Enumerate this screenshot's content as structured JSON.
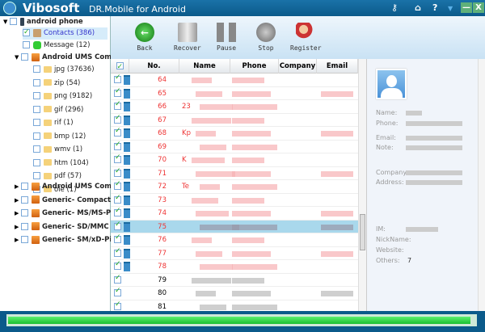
{
  "title": {
    "brand": "Vibosoft",
    "subtitle": "DR.Mobile for Android"
  },
  "tree": {
    "root": "android phone",
    "contacts": "Contacts (386)",
    "message": "Message (12)",
    "storage": "Android   UMS Com...",
    "folders": [
      "jpg (37636)",
      "zip (54)",
      "png (9182)",
      "gif (296)",
      "rif (1)",
      "bmp (12)",
      "wmv (1)",
      "htm (104)",
      "pdf (57)",
      "ole (1)"
    ],
    "drives": [
      "Android   UMS Com...",
      "Generic- Compact Fl...",
      "Generic- MS/MS-Pr...",
      "Generic- SD/MMC U...",
      "Generic- SM/xD-Pic..."
    ]
  },
  "toolbar": {
    "back": "Back",
    "recover": "Recover",
    "pause": "Pause",
    "stop": "Stop",
    "register": "Register"
  },
  "table": {
    "headers": [
      "No.",
      "Name",
      "Phone",
      "Company",
      "Email"
    ],
    "rows": [
      {
        "no": "64",
        "name": "",
        "deleted": true
      },
      {
        "no": "65",
        "name": "",
        "deleted": true
      },
      {
        "no": "66",
        "name": "23",
        "deleted": true
      },
      {
        "no": "67",
        "name": "",
        "deleted": true
      },
      {
        "no": "68",
        "name": "Kp",
        "deleted": true
      },
      {
        "no": "69",
        "name": "",
        "deleted": true
      },
      {
        "no": "70",
        "name": "K",
        "deleted": true
      },
      {
        "no": "71",
        "name": "",
        "deleted": true
      },
      {
        "no": "72",
        "name": "Te",
        "deleted": true
      },
      {
        "no": "73",
        "name": "",
        "deleted": true
      },
      {
        "no": "74",
        "name": "",
        "deleted": true
      },
      {
        "no": "75",
        "name": "",
        "deleted": true,
        "selected": true
      },
      {
        "no": "76",
        "name": "",
        "deleted": true
      },
      {
        "no": "77",
        "name": "",
        "deleted": true
      },
      {
        "no": "78",
        "name": "",
        "deleted": true
      },
      {
        "no": "79",
        "name": "",
        "deleted": false
      },
      {
        "no": "80",
        "name": "",
        "deleted": false
      },
      {
        "no": "81",
        "name": "",
        "deleted": false
      }
    ]
  },
  "detail": {
    "labels": [
      "Name:",
      "Phone:",
      "Email:",
      "Note:",
      "Company:",
      "Address:",
      "IM:",
      "NickName:",
      "Website:",
      "Others:"
    ],
    "others_value": "7"
  },
  "progress": {
    "percent": 99
  },
  "colors": {
    "titlebar": "#0b5a8a",
    "deleted": "#ee3333",
    "selected": "#a9d8ec"
  }
}
